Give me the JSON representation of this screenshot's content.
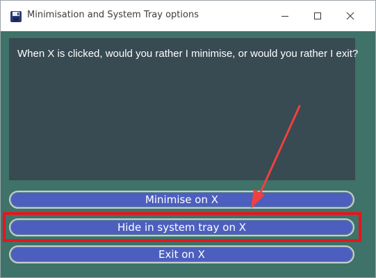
{
  "window": {
    "title": "Minimisation and System Tray options"
  },
  "titlebar_controls": {
    "minimize_icon": "minimize-icon",
    "maximize_icon": "maximize-icon",
    "close_icon": "close-icon"
  },
  "message": {
    "text": "When X is clicked, would you rather I minimise, or would you rather I exit?"
  },
  "buttons": {
    "minimise_label": "Minimise on X",
    "tray_label": "Hide in system tray on X",
    "exit_label": "Exit on X"
  },
  "annotations": {
    "highlight_color": "#e8141c",
    "arrow_color": "#f04040"
  },
  "colors": {
    "client_background": "#3f7268",
    "panel_background": "#384a52",
    "button_background": "#4d5fbe"
  }
}
